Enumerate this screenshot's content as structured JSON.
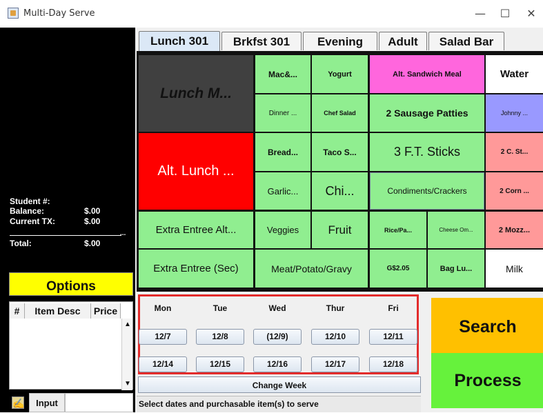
{
  "window": {
    "title": "Multi-Day Serve",
    "minimize": "—",
    "maximize": "☐",
    "close": "✕"
  },
  "student": {
    "student_label": "Student #:",
    "balance_label": "Balance:",
    "balance_value": "$.00",
    "current_tx_label": "Current TX:",
    "current_tx_value": "$.00",
    "ellipsis": "...",
    "total_label": "Total:",
    "total_value": "$.00"
  },
  "options_label": "Options",
  "item_table": {
    "columns": [
      "#",
      "Item Desc",
      "Price"
    ]
  },
  "input": {
    "label": "Input",
    "value": ""
  },
  "tabs": [
    {
      "label": "Lunch 301",
      "active": true
    },
    {
      "label": "Brkfst 301",
      "active": false
    },
    {
      "label": "Evening",
      "active": false
    },
    {
      "label": "Adult",
      "active": false
    },
    {
      "label": "Salad Bar",
      "active": false
    }
  ],
  "menu_items": [
    {
      "label": "Lunch M...",
      "color": "#404040"
    },
    {
      "label": "Alt. Lunch ...",
      "color": "#ff0000"
    },
    {
      "label": "Extra Entree Alt...",
      "color": "#90ee90"
    },
    {
      "label": "Extra Entree (Sec)",
      "color": "#90ee90"
    },
    {
      "label": "Mac&...",
      "color": "#90ee90"
    },
    {
      "label": "Yogurt",
      "color": "#90ee90"
    },
    {
      "label": "Dinner ...",
      "color": "#90ee90"
    },
    {
      "label": "Chef Salad",
      "color": "#90ee90"
    },
    {
      "label": "Bread...",
      "color": "#90ee90"
    },
    {
      "label": "Taco S...",
      "color": "#90ee90"
    },
    {
      "label": "Garlic...",
      "color": "#90ee90"
    },
    {
      "label": "Chi...",
      "color": "#90ee90"
    },
    {
      "label": "Veggies",
      "color": "#90ee90"
    },
    {
      "label": "Fruit",
      "color": "#90ee90"
    },
    {
      "label": "Meat/Potato/Gravy",
      "color": "#90ee90"
    },
    {
      "label": "Alt. Sandwich Meal",
      "color": "#ff66dd"
    },
    {
      "label": "2 Sausage Patties",
      "color": "#90ee90"
    },
    {
      "label": "3 F.T. Sticks",
      "color": "#90ee90"
    },
    {
      "label": "Condiments/Crackers",
      "color": "#90ee90"
    },
    {
      "label": "Rice/Pa...",
      "color": "#90ee90"
    },
    {
      "label": "Cheese Om...",
      "color": "#90ee90"
    },
    {
      "label": "G$2.05",
      "color": "#90ee90"
    },
    {
      "label": "Bag Lu...",
      "color": "#90ee90"
    },
    {
      "label": "Water",
      "color": "#ffffff"
    },
    {
      "label": "Johnny ...",
      "color": "#9999ff"
    },
    {
      "label": "2 C. St...",
      "color": "#ff9999"
    },
    {
      "label": "2 Corn ...",
      "color": "#ff9999"
    },
    {
      "label": "2 Mozz...",
      "color": "#ff9999"
    },
    {
      "label": "Milk",
      "color": "#ffffff"
    }
  ],
  "calendar": {
    "days": [
      "Mon",
      "Tue",
      "Wed",
      "Thur",
      "Fri"
    ],
    "week1": [
      "12/7",
      "12/8",
      "(12/9)",
      "12/10",
      "12/11"
    ],
    "week2": [
      "12/14",
      "12/15",
      "12/16",
      "12/17",
      "12/18"
    ],
    "change_week_label": "Change Week"
  },
  "status_text": "Select dates and purchasable item(s) to serve",
  "search_label": "Search",
  "process_label": "Process"
}
